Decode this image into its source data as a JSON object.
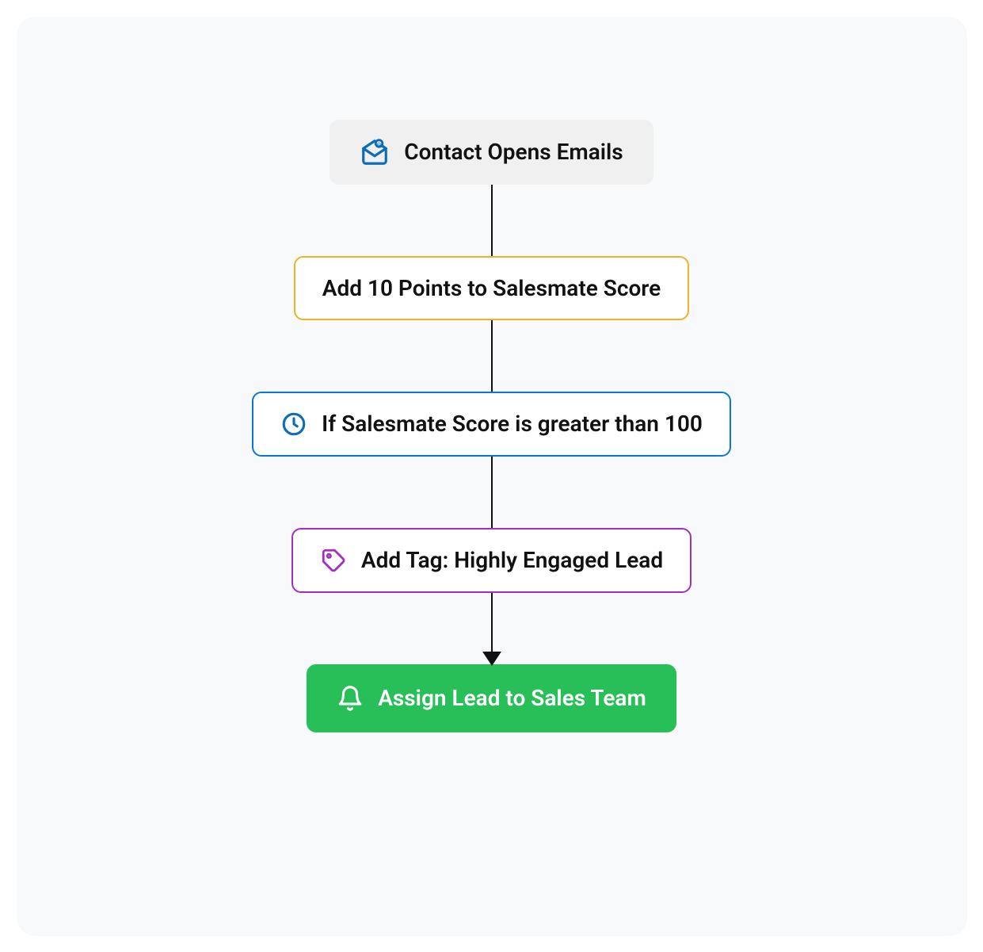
{
  "workflow": {
    "steps": [
      {
        "label": "Contact Opens Emails"
      },
      {
        "label": "Add 10 Points to Salesmate Score"
      },
      {
        "label": "If Salesmate Score is greater than 100"
      },
      {
        "label": "Add Tag: Highly Engaged Lead"
      },
      {
        "label": "Assign Lead to Sales Team"
      }
    ]
  },
  "colors": {
    "trigger_bg": "#f0f0f1",
    "yellow": "#ecb22e",
    "blue": "#0b78d0",
    "purple": "#a22fc2",
    "green": "#28bf58",
    "canvas_bg": "#f8f9fb"
  }
}
